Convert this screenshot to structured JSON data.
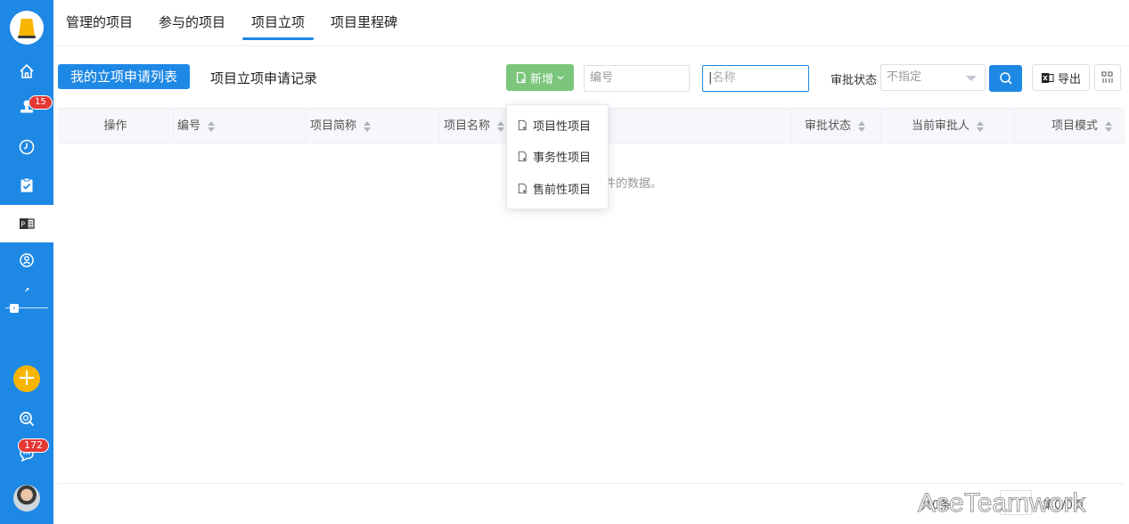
{
  "sidebar": {
    "badges": {
      "notifications": "15",
      "messages": "172"
    },
    "items": [
      {
        "icon": "home-icon"
      },
      {
        "icon": "stamp-icon"
      },
      {
        "icon": "clock-icon"
      },
      {
        "icon": "clipboard-check-icon"
      },
      {
        "icon": "project-icon"
      },
      {
        "icon": "team-icon"
      },
      {
        "icon": "expand-icon"
      },
      {
        "icon": "search-icon"
      },
      {
        "icon": "chat-icon"
      }
    ],
    "accent": "#1e88e5",
    "add_color": "#f7b500"
  },
  "top_tabs": [
    "管理的项目",
    "参与的项目",
    "项目立项",
    "项目里程碑"
  ],
  "active_top_tab": "项目立项",
  "toolbar": {
    "tab_primary": "我的立项申请列表",
    "tab_secondary": "项目立项申请记录",
    "new_label": "新增",
    "code_placeholder": "编号",
    "name_placeholder": "名称",
    "approve_label": "审批状态",
    "approve_value": "不指定",
    "export_label": "导出",
    "new_color": "#7bc67b"
  },
  "table": {
    "columns": [
      "操作",
      "编号",
      "项目简称",
      "项目名称",
      "审批状态",
      "当前审批人",
      "项目模式"
    ],
    "empty_text": "件的数据。"
  },
  "dropdown": {
    "items": [
      "项目性项目",
      "事务性项目",
      "售前性项目"
    ]
  },
  "pager": {
    "total": "共0条",
    "page_info": "第0/0页"
  },
  "watermark": "AceTeamwork"
}
